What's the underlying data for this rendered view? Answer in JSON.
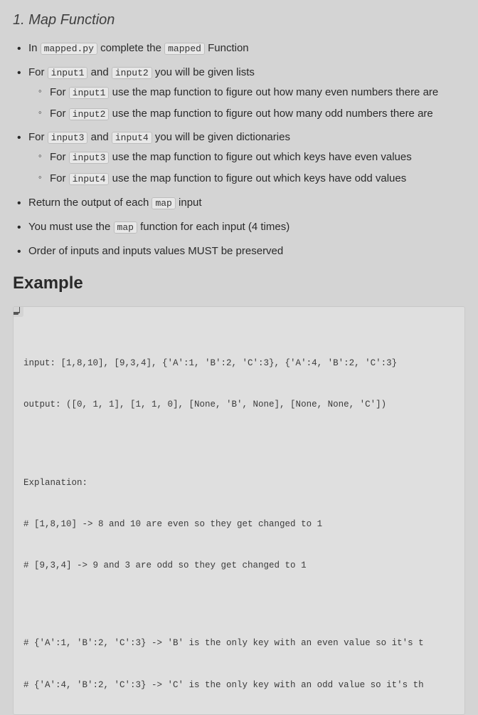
{
  "title": "1. Map Function",
  "bullets": {
    "b1_pre": "In ",
    "b1_code1": "mapped.py",
    "b1_mid": " complete the ",
    "b1_code2": "mapped",
    "b1_post": " Function",
    "b2_pre": "For ",
    "b2_code1": "input1",
    "b2_mid": " and ",
    "b2_code2": "input2",
    "b2_post": " you will be given lists",
    "b2a_pre": "For ",
    "b2a_code": "input1",
    "b2a_post": " use the map function to figure out how many even numbers there are",
    "b2b_pre": "For ",
    "b2b_code": "input2",
    "b2b_post": " use the map function to figure out how many odd numbers there are",
    "b3_pre": "For ",
    "b3_code1": "input3",
    "b3_mid": " and ",
    "b3_code2": "input4",
    "b3_post": " you will be given dictionaries",
    "b3a_pre": "For ",
    "b3a_code": "input3",
    "b3a_post": " use the map function to figure out which keys have even values",
    "b3b_pre": "For ",
    "b3b_code": "input4",
    "b3b_post": " use the map function to figure out which keys have odd values",
    "b4_pre": "Return the output of each ",
    "b4_code": "map",
    "b4_post": " input",
    "b5_pre": "You must use the ",
    "b5_code": "map",
    "b5_post": " function for each input (4 times)",
    "b6": "Order of inputs and inputs values MUST be preserved"
  },
  "example_heading": "Example",
  "code": {
    "l1": "input: [1,8,10], [9,3,4], {'A':1, 'B':2, 'C':3}, {'A':4, 'B':2, 'C':3}",
    "l2": "output: ([0, 1, 1], [1, 1, 0], [None, 'B', None], [None, None, 'C'])",
    "l3": "Explanation:",
    "l4": "# [1,8,10] -> 8 and 10 are even so they get changed to 1",
    "l5": "# [9,3,4] -> 9 and 3 are odd so they get changed to 1",
    "l6": "# {'A':1, 'B':2, 'C':3} -> 'B' is the only key with an even value so it's t",
    "l7": "# {'A':4, 'B':2, 'C':3} -> 'C' is the only key with an odd value so it's th"
  }
}
